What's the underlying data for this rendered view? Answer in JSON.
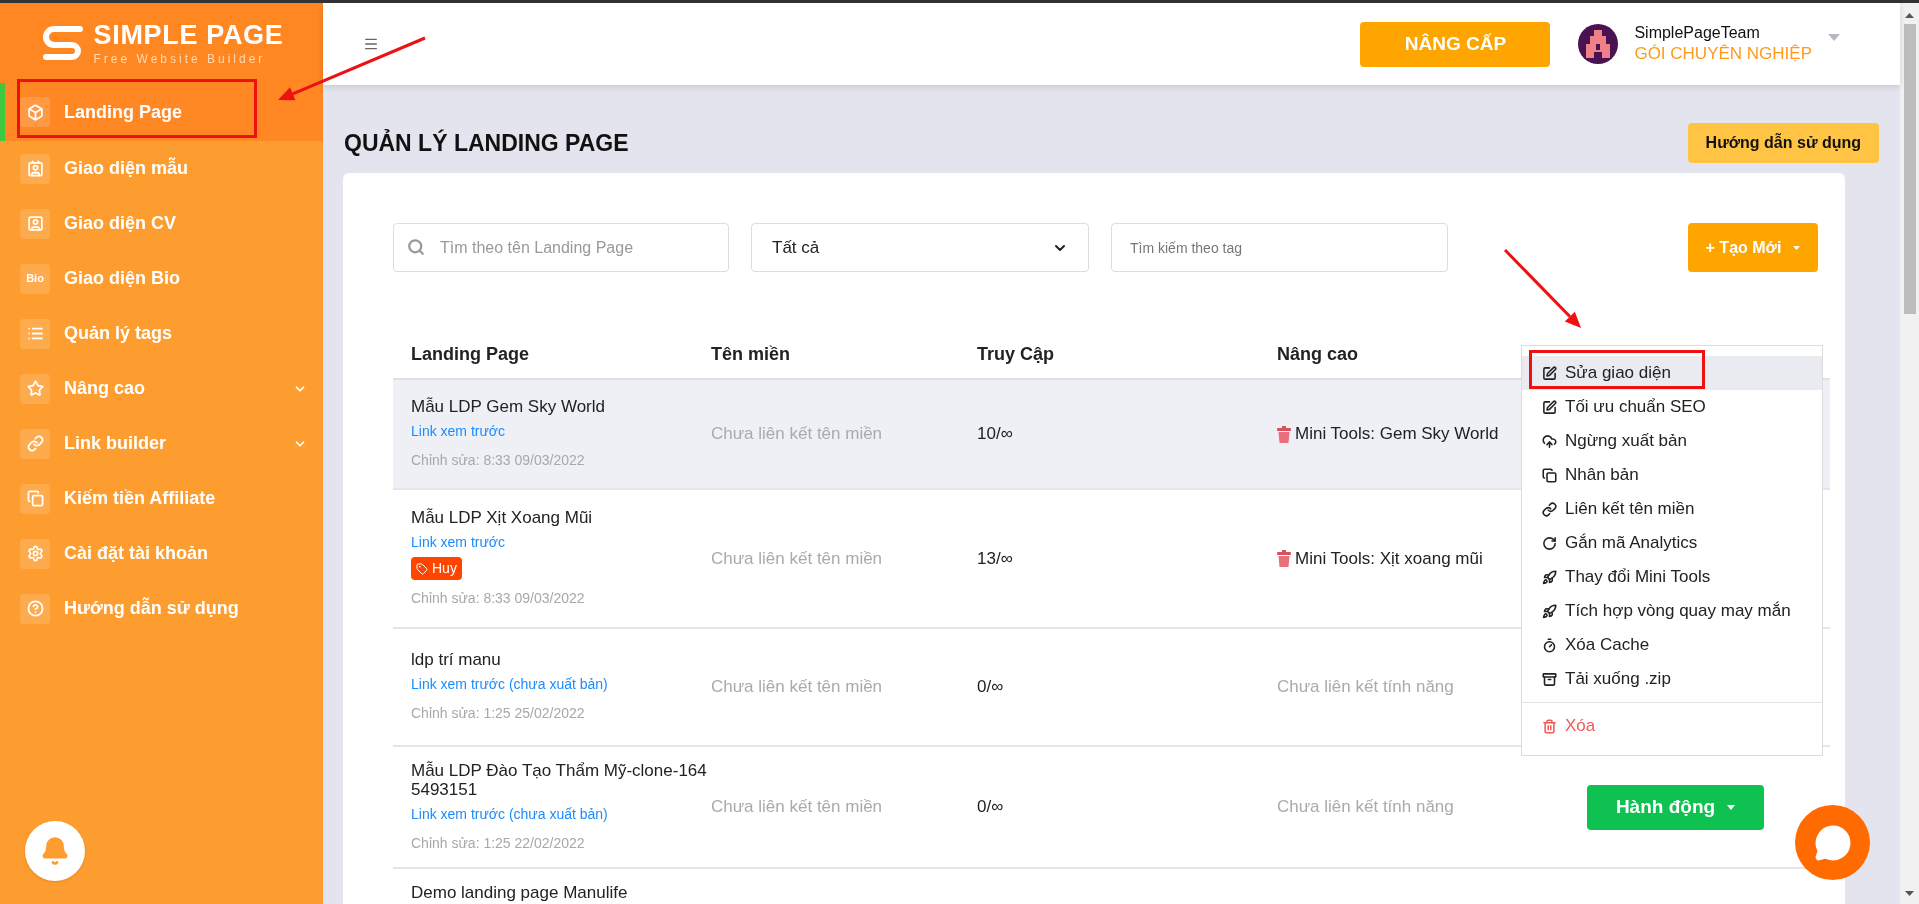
{
  "sidebar": {
    "logo": {
      "title": "SIMPLE PAGE",
      "subtitle": "Free Website Builder"
    },
    "items": [
      {
        "label": "Landing Page",
        "selected": true,
        "has_submenu": false
      },
      {
        "label": "Giao diện mẫu",
        "selected": false,
        "has_submenu": false
      },
      {
        "label": "Giao diện CV",
        "selected": false,
        "has_submenu": false
      },
      {
        "label": "Giao diện Bio",
        "selected": false,
        "has_submenu": false,
        "icon_text": "Bio"
      },
      {
        "label": "Quản lý tags",
        "selected": false,
        "has_submenu": false
      },
      {
        "label": "Nâng cao",
        "selected": false,
        "has_submenu": true
      },
      {
        "label": "Link builder",
        "selected": false,
        "has_submenu": true
      },
      {
        "label": "Kiếm tiền Affiliate",
        "selected": false,
        "has_submenu": false
      },
      {
        "label": "Cài đặt tài khoản",
        "selected": false,
        "has_submenu": false
      },
      {
        "label": "Hướng dẫn sử dụng",
        "selected": false,
        "has_submenu": false
      }
    ]
  },
  "header": {
    "upgrade_button": "NÂNG CẤP",
    "user": {
      "name": "SimplePageTeam",
      "plan": "GÓI CHUYÊN NGHIỆP"
    }
  },
  "page": {
    "title": "QUẢN LÝ LANDING PAGE",
    "guide_button": "Hướng dẫn sử dụng"
  },
  "filters": {
    "search": {
      "placeholder": "Tìm theo tên Landing Page"
    },
    "status": {
      "value": "Tất cả"
    },
    "tag_search": {
      "placeholder": "Tìm kiếm theo tag"
    },
    "create_button": "+ Tạo Mới"
  },
  "table": {
    "columns": [
      "Landing Page",
      "Tên miền",
      "Truy Cập",
      "Nâng cao"
    ],
    "rows": [
      {
        "selected": true,
        "name": "Mẫu LDP Gem Sky World",
        "preview_link": "Link xem trước",
        "edited": "Chỉnh sửa: 8:33 09/03/2022",
        "domain": "Chưa liên kết tên miền",
        "access": "10/∞",
        "advanced": {
          "kind": "tool",
          "text": "Mini Tools: Gem Sky World"
        }
      },
      {
        "selected": false,
        "name": "Mẫu LDP Xịt Xoang Mũi",
        "preview_link": "Link xem trước",
        "tags": [
          "Huy"
        ],
        "edited": "Chỉnh sửa: 8:33 09/03/2022",
        "domain": "Chưa liên kết tên miền",
        "access": "13/∞",
        "advanced": {
          "kind": "tool",
          "text": "Mini Tools: Xịt xoang mũi"
        }
      },
      {
        "selected": false,
        "name": "ldp trí manu",
        "preview_link": "Link xem trước (chưa xuất bản)",
        "edited": "Chỉnh sửa: 1:25 25/02/2022",
        "domain": "Chưa liên kết tên miền",
        "access": "0/∞",
        "advanced": {
          "kind": "none",
          "text": "Chưa liên kết tính năng"
        }
      },
      {
        "selected": false,
        "name": "Mẫu LDP Đào Tạo Thẩm Mỹ-clone-1645493151",
        "preview_link": "Link xem trước (chưa xuất bản)",
        "edited": "Chỉnh sửa: 1:25 22/02/2022",
        "domain": "Chưa liên kết tên miền",
        "access": "0/∞",
        "advanced": {
          "kind": "none",
          "text": "Chưa liên kết tính năng"
        },
        "action_button": "Hành động"
      },
      {
        "selected": false,
        "name": "Demo landing page Manulife"
      }
    ]
  },
  "action_menu": {
    "items": [
      {
        "label": "Sửa giao diện",
        "kind": "normal",
        "selected": true
      },
      {
        "label": "Tối ưu chuẩn SEO",
        "kind": "normal",
        "selected": false
      },
      {
        "label": "Ngừng xuất bản",
        "kind": "normal",
        "selected": false
      },
      {
        "label": "Nhân bản",
        "kind": "normal",
        "selected": false
      },
      {
        "label": "Liên kết tên miền",
        "kind": "normal",
        "selected": false
      },
      {
        "label": "Gắn mã Analytics",
        "kind": "normal",
        "selected": false
      },
      {
        "label": "Thay đổi Mini Tools",
        "kind": "normal",
        "selected": false
      },
      {
        "label": "Tích hợp vòng quay may mắn",
        "kind": "normal",
        "selected": false
      },
      {
        "label": "Xóa Cache",
        "kind": "normal",
        "selected": false
      },
      {
        "label": "Tải xuống .zip",
        "kind": "normal",
        "selected": false
      },
      {
        "label": "Xóa",
        "kind": "danger",
        "selected": false
      }
    ]
  }
}
